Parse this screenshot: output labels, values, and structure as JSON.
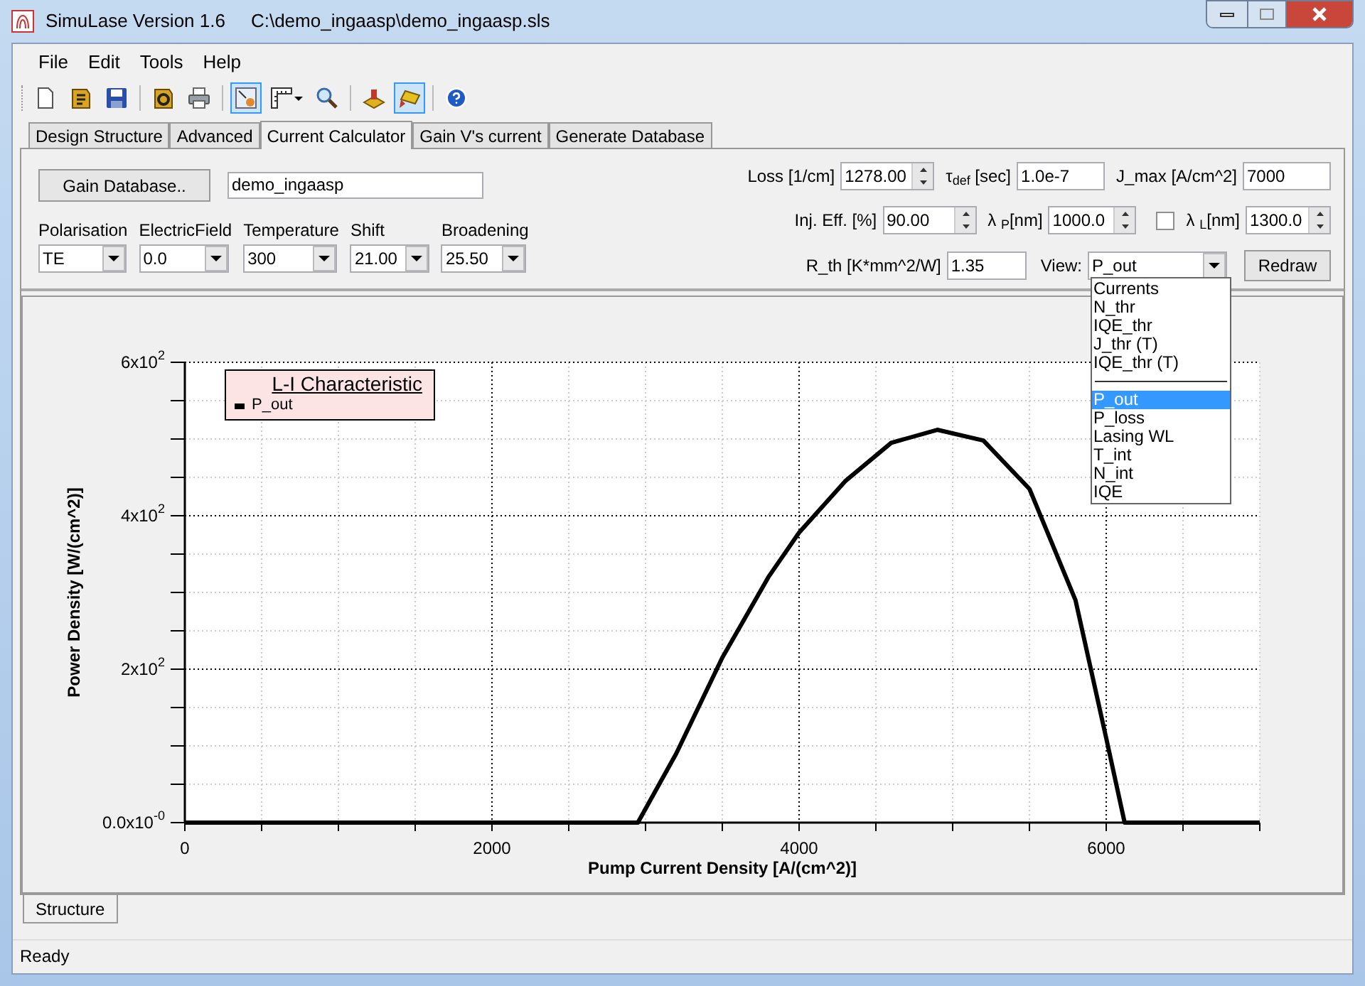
{
  "window": {
    "title": "SimuLase Version 1.6",
    "path": "C:\\demo_ingaasp\\demo_ingaasp.sls"
  },
  "menu": [
    "File",
    "Edit",
    "Tools",
    "Help"
  ],
  "toolbar": [
    {
      "kind": "button",
      "pressed": false
    },
    {
      "kind": "button",
      "pressed": false
    },
    {
      "kind": "button",
      "pressed": false
    },
    {
      "kind": "separator"
    },
    {
      "kind": "button",
      "pressed": false
    },
    {
      "kind": "button",
      "pressed": false
    },
    {
      "kind": "separator"
    },
    {
      "kind": "button",
      "pressed": true
    },
    {
      "kind": "button",
      "pressed": false
    },
    {
      "kind": "button",
      "pressed": false
    },
    {
      "kind": "separator"
    },
    {
      "kind": "button",
      "pressed": false
    },
    {
      "kind": "button",
      "pressed": true
    },
    {
      "kind": "separator"
    },
    {
      "kind": "button",
      "pressed": false
    }
  ],
  "tabs": [
    {
      "label": "Design Structure",
      "selected": false
    },
    {
      "label": "Advanced",
      "selected": false
    },
    {
      "label": "Current Calculator",
      "selected": true
    },
    {
      "label": "Gain V's current",
      "selected": false
    },
    {
      "label": "Generate Database",
      "selected": false
    }
  ],
  "gain_database": {
    "button": "Gain Database..",
    "value": "demo_ingaasp"
  },
  "selectors": [
    {
      "label": "Polarisation",
      "value": "TE"
    },
    {
      "label": "ElectricField",
      "value": "0.0"
    },
    {
      "label": "Temperature",
      "value": "300"
    },
    {
      "label": "Shift",
      "value": "21.00"
    },
    {
      "label": "Broadening",
      "value": "25.50"
    }
  ],
  "parameter_rows": [
    [
      {
        "kind": "spin",
        "label": "Loss [1/cm]",
        "value": "1278.00"
      },
      {
        "kind": "text",
        "label": "τ$_{def}$ [sec]",
        "value": "1.0e-7"
      },
      {
        "kind": "text",
        "label": "J_max [A/cm^2]",
        "value": "7000"
      }
    ],
    [
      {
        "kind": "spin",
        "label": "Inj. Eff. [%]",
        "value": "90.00"
      },
      {
        "kind": "spin",
        "label": "λ $_{P}$[nm]",
        "value": "1000.0"
      },
      {
        "kind": "checkspin",
        "checked": false,
        "label": "λ $_{L}$[nm]",
        "value": "1300.0"
      }
    ]
  ],
  "r_th": {
    "label": "R_th [K*mm^2/W]",
    "value": "1.35"
  },
  "view": {
    "label": "View:",
    "value": "P_out",
    "expanded": true,
    "options": [
      {
        "kind": "item",
        "label": "Currents",
        "selected": false
      },
      {
        "kind": "item",
        "label": "N_thr",
        "selected": false
      },
      {
        "kind": "item",
        "label": "IQE_thr",
        "selected": false
      },
      {
        "kind": "item",
        "label": "J_thr (T)",
        "selected": false
      },
      {
        "kind": "item",
        "label": "IQE_thr (T)",
        "selected": false
      },
      {
        "kind": "separator"
      },
      {
        "kind": "item",
        "label": "P_out",
        "selected": true
      },
      {
        "kind": "item",
        "label": "P_loss",
        "selected": false
      },
      {
        "kind": "item",
        "label": "Lasing WL",
        "selected": false
      },
      {
        "kind": "item",
        "label": "T_int",
        "selected": false
      },
      {
        "kind": "item",
        "label": "N_int",
        "selected": false
      },
      {
        "kind": "item",
        "label": "IQE",
        "selected": false
      }
    ]
  },
  "redraw_button": "Redraw",
  "chart_data": {
    "type": "line",
    "title": "L-I Characteristic",
    "xlabel": "Pump Current Density [A/(cm^2)]",
    "ylabel": "Power Density [W/(cm^2)]",
    "x": [
      0,
      2950,
      3200,
      3500,
      3800,
      4000,
      4300,
      4600,
      4900,
      5200,
      5500,
      5800,
      6000,
      6120,
      7000
    ],
    "series": [
      {
        "name": "P_out",
        "color": "#000000",
        "values": [
          0,
          0,
          90,
          215,
          320,
          378,
          445,
          495,
          512,
          498,
          435,
          290,
          110,
          0,
          0
        ]
      }
    ],
    "xlim": [
      0,
      7000
    ],
    "ylim": [
      0,
      600
    ],
    "grid": true,
    "xticks": [
      0,
      2000,
      4000,
      6000
    ],
    "yticks": [
      {
        "value": 0,
        "label": "0.0x10$^{-0}$"
      },
      {
        "value": 200,
        "label": "2x10$^{2}$"
      },
      {
        "value": 400,
        "label": "4x10$^{2}$"
      },
      {
        "value": 600,
        "label": "6x10$^{2}$"
      }
    ]
  },
  "bottom_tabs": [
    {
      "label": "Structure",
      "selected": true
    }
  ],
  "status_bar": "Ready"
}
